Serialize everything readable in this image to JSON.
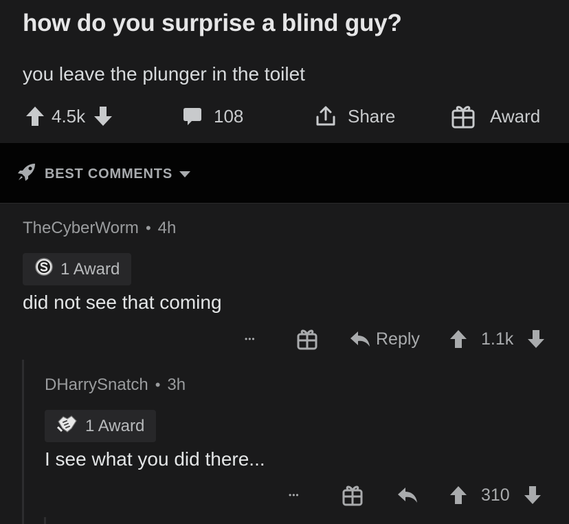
{
  "post": {
    "title": "how do you surprise a blind guy?",
    "body": "you leave the plunger in the toilet",
    "score": "4.5k",
    "comment_count": "108",
    "share_label": "Share",
    "award_label": "Award"
  },
  "sort": {
    "label": "BEST COMMENTS"
  },
  "comments": [
    {
      "author": "TheCyberWorm",
      "separator": "•",
      "age": "4h",
      "award_label": "1 Award",
      "award_icon": "silver-award-icon",
      "text": "did not see that coming",
      "more_label": "•••",
      "reply_label": "Reply",
      "score": "1.1k"
    },
    {
      "author": "DHarrySnatch",
      "separator": "•",
      "age": "3h",
      "award_label": "1 Award",
      "award_icon": "handshake-award-icon",
      "text": "I see what you did there...",
      "more_label": "•••",
      "score": "310"
    }
  ],
  "colors": {
    "background": "#1a1a1b",
    "sortbar_background": "#030303",
    "chip_background": "#272729",
    "text_primary": "#e3e5e6",
    "text_muted": "#9a9c9e"
  }
}
